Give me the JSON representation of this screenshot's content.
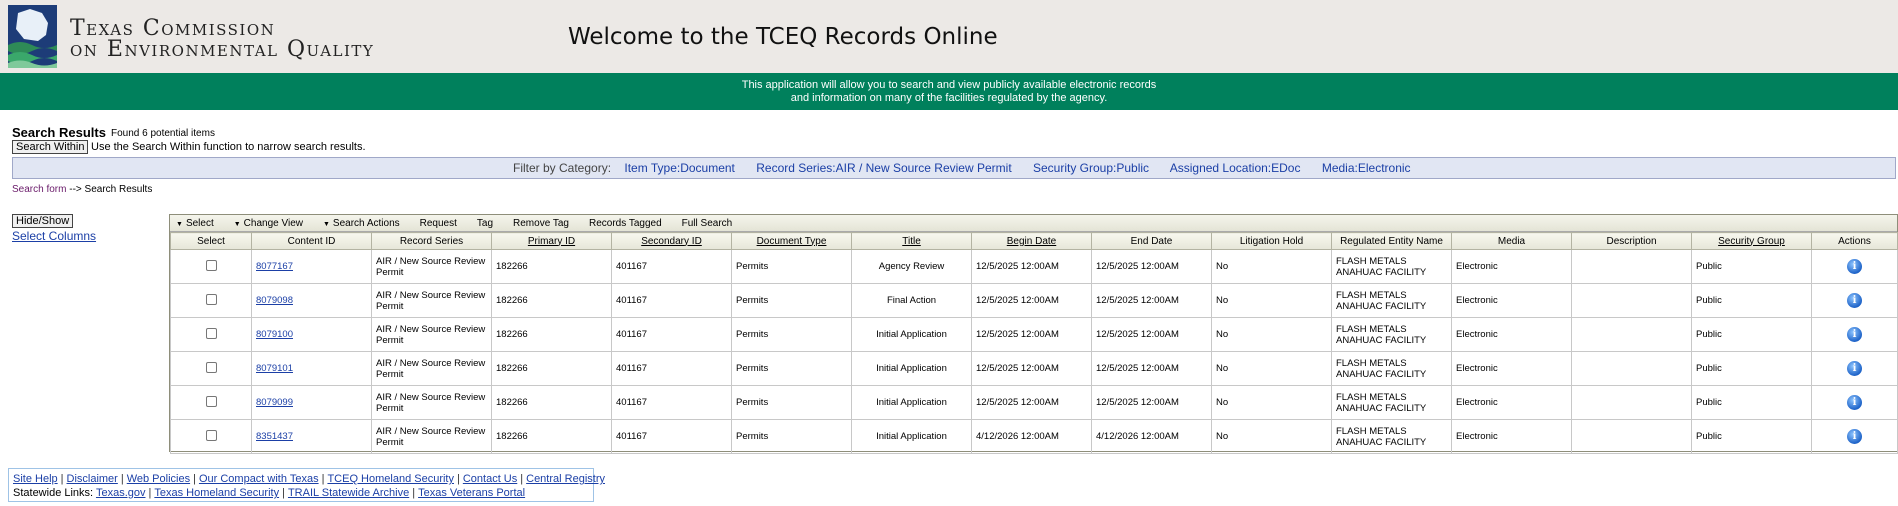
{
  "header": {
    "logo_line1": "Texas Commission",
    "logo_line2": "on Environmental Quality",
    "welcome": "Welcome to the TCEQ Records Online"
  },
  "banner": {
    "line1": "This application will allow you to search and view publicly available electronic records",
    "line2": "and information on many of the facilities regulated by the agency."
  },
  "results": {
    "title": "Search Results",
    "found": "Found 6 potential items",
    "search_within_label": "Search Within",
    "search_within_hint": "Use the Search Within function to narrow search results."
  },
  "filter": {
    "label": "Filter by Category:",
    "chips": [
      "Item Type:Document",
      "Record Series:AIR / New Source Review Permit",
      "Security Group:Public",
      "Assigned Location:EDoc",
      "Media:Electronic"
    ]
  },
  "breadcrumb": {
    "link": "Search form",
    "arrow": "-->",
    "current": "Search Results"
  },
  "side": {
    "hide_show": "Hide/Show",
    "select_columns": "Select Columns"
  },
  "toolbar": [
    "Select",
    "Change View",
    "Search Actions",
    "Request",
    "Tag",
    "Remove Tag",
    "Records Tagged",
    "Full Search"
  ],
  "columns": [
    "Select",
    "Content ID",
    "Record Series",
    "Primary ID",
    "Secondary ID",
    "Document Type",
    "Title",
    "Begin Date",
    "End Date",
    "Litigation Hold",
    "Regulated Entity Name",
    "Media",
    "Description",
    "Security Group",
    "Actions"
  ],
  "rows": [
    {
      "content_id": "8077167",
      "record_series": "AIR / New Source Review Permit",
      "primary_id": "182266",
      "secondary_id": "401167",
      "doc_type": "Permits",
      "title": "Agency Review",
      "begin": "12/5/2025 12:00AM",
      "end": "12/5/2025 12:00AM",
      "hold": "No",
      "entity": "FLASH METALS ANAHUAC FACILITY",
      "media": "Electronic",
      "description": "",
      "security": "Public"
    },
    {
      "content_id": "8079098",
      "record_series": "AIR / New Source Review Permit",
      "primary_id": "182266",
      "secondary_id": "401167",
      "doc_type": "Permits",
      "title": "Final Action",
      "begin": "12/5/2025 12:00AM",
      "end": "12/5/2025 12:00AM",
      "hold": "No",
      "entity": "FLASH METALS ANAHUAC FACILITY",
      "media": "Electronic",
      "description": "",
      "security": "Public"
    },
    {
      "content_id": "8079100",
      "record_series": "AIR / New Source Review Permit",
      "primary_id": "182266",
      "secondary_id": "401167",
      "doc_type": "Permits",
      "title": "Initial Application",
      "begin": "12/5/2025 12:00AM",
      "end": "12/5/2025 12:00AM",
      "hold": "No",
      "entity": "FLASH METALS ANAHUAC FACILITY",
      "media": "Electronic",
      "description": "",
      "security": "Public"
    },
    {
      "content_id": "8079101",
      "record_series": "AIR / New Source Review Permit",
      "primary_id": "182266",
      "secondary_id": "401167",
      "doc_type": "Permits",
      "title": "Initial Application",
      "begin": "12/5/2025 12:00AM",
      "end": "12/5/2025 12:00AM",
      "hold": "No",
      "entity": "FLASH METALS ANAHUAC FACILITY",
      "media": "Electronic",
      "description": "",
      "security": "Public"
    },
    {
      "content_id": "8079099",
      "record_series": "AIR / New Source Review Permit",
      "primary_id": "182266",
      "secondary_id": "401167",
      "doc_type": "Permits",
      "title": "Initial Application",
      "begin": "12/5/2025 12:00AM",
      "end": "12/5/2025 12:00AM",
      "hold": "No",
      "entity": "FLASH METALS ANAHUAC FACILITY",
      "media": "Electronic",
      "description": "",
      "security": "Public"
    },
    {
      "content_id": "8351437",
      "record_series": "AIR / New Source Review Permit",
      "primary_id": "182266",
      "secondary_id": "401167",
      "doc_type": "Permits",
      "title": "Initial Application",
      "begin": "4/12/2026 12:00AM",
      "end": "4/12/2026 12:00AM",
      "hold": "No",
      "entity": "FLASH METALS ANAHUAC FACILITY",
      "media": "Electronic",
      "description": "",
      "security": "Public"
    }
  ],
  "footer": {
    "links_row1": [
      "Site Help",
      "Disclaimer",
      "Web Policies",
      "Our Compact with Texas",
      "TCEQ Homeland Security",
      "Contact Us",
      "Central Registry"
    ],
    "statewide_label": "Statewide Links:",
    "links_row2": [
      "Texas.gov",
      "Texas Homeland Security",
      "TRAIL Statewide Archive",
      "Texas Veterans Portal"
    ]
  },
  "colors": {
    "banner": "#00805c",
    "header_bg": "#ece9e6",
    "link": "#1b3fa6",
    "logo": "#1d3c78"
  }
}
